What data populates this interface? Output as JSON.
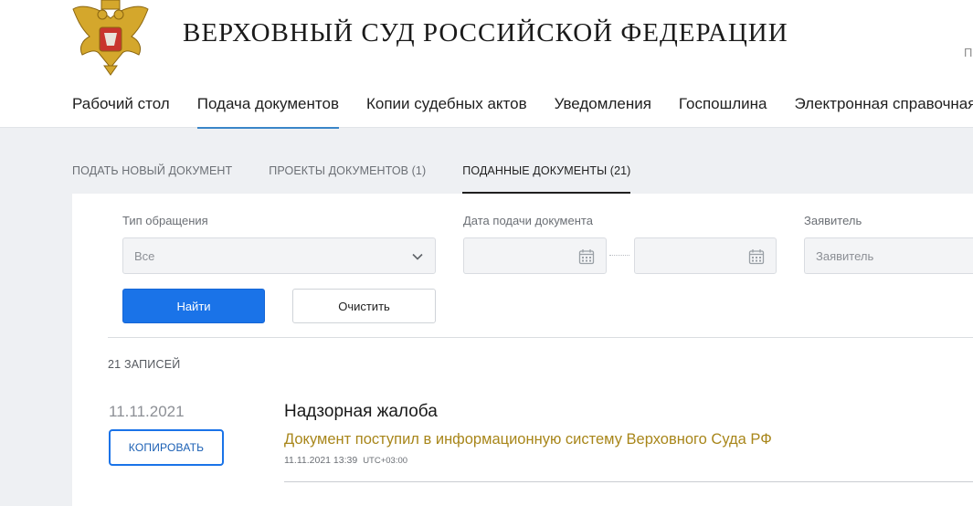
{
  "header": {
    "title": "ВЕРХОВНЫЙ СУД РОССИЙСКОЙ ФЕДЕРАЦИИ",
    "corner_text": "П",
    "emblem_icon": "russian-coat-of-arms-icon"
  },
  "nav": {
    "items": [
      {
        "label": "Рабочий стол",
        "active": false
      },
      {
        "label": "Подача документов",
        "active": true
      },
      {
        "label": "Копии судебных актов",
        "active": false
      },
      {
        "label": "Уведомления",
        "active": false
      },
      {
        "label": "Госпошлина",
        "active": false
      },
      {
        "label": "Электронная справочная",
        "active": false
      }
    ]
  },
  "tabs": [
    {
      "label": "ПОДАТЬ НОВЫЙ ДОКУМЕНТ",
      "active": false
    },
    {
      "label": "ПРОЕКТЫ ДОКУМЕНТОВ (1)",
      "active": false
    },
    {
      "label": "ПОДАННЫЕ ДОКУМЕНТЫ (21)",
      "active": true
    }
  ],
  "filters": {
    "type_label": "Тип обращения",
    "type_value": "Все",
    "date_label": "Дата подачи документа",
    "date_from": "",
    "date_to": "",
    "applicant_label": "Заявитель",
    "applicant_placeholder": "Заявитель",
    "find_button": "Найти",
    "clear_button": "Очистить"
  },
  "results": {
    "count_text": "21 ЗАПИСЕЙ",
    "records": [
      {
        "date": "11.11.2021",
        "copy_button": "КОПИРОВАТЬ",
        "title": "Надзорная жалоба",
        "status": "Документ поступил в информационную систему Верховного Суда РФ",
        "status_datetime": "11.11.2021 13:39",
        "timezone": "UTC+03:00"
      }
    ]
  },
  "colors": {
    "primary": "#1a73e8",
    "status": "#a8861a",
    "nav_active_underline": "#3a86c8",
    "background": "#eef0f3"
  }
}
